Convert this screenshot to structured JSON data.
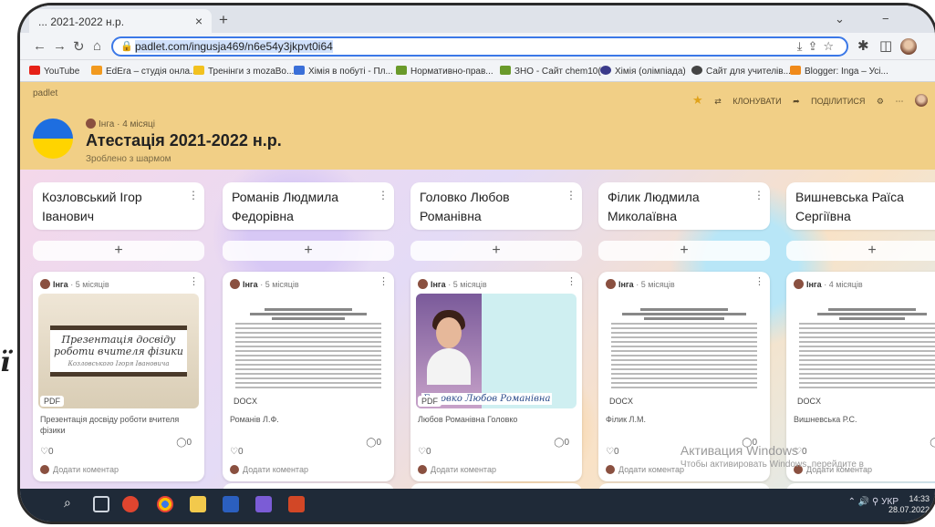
{
  "browser": {
    "tab_title": "... 2021-2022 н.р.",
    "url_host": "padlet.com",
    "url_path": "/ingusja469/n6e54y3jkpvt0i64",
    "bookmarks": [
      {
        "label": "YouTube",
        "color": "#e62117"
      },
      {
        "label": "EdEra – студія онла...",
        "color": "#f29a1f"
      },
      {
        "label": "Тренінги з mozaBo...",
        "color": "#f2c11f"
      },
      {
        "label": "Хімія в побуті - Пл...",
        "color": "#3a6fd8"
      },
      {
        "label": "Нормативно-прав...",
        "color": "#6a9a2a"
      },
      {
        "label": "ЗНО - Сайт chem10(",
        "color": "#6a9a2a"
      },
      {
        "label": "Хімія (олімпіада)",
        "color": "#3a3a8a"
      },
      {
        "label": "Сайт для учителів...",
        "color": "#444444"
      },
      {
        "label": "Blogger: Inga – Усі...",
        "color": "#f08a1a"
      }
    ]
  },
  "padlet": {
    "logo": "padlet",
    "author": "Інга",
    "age": "4 місяці",
    "title": "Атестація 2021-2022 н.р.",
    "subtitle": "Зроблено з шармом",
    "actions": {
      "clone": "КЛОНУВАТИ",
      "share": "ПОДІЛИТИСЯ"
    }
  },
  "columns": [
    {
      "title_line1": "Козловський Ігор",
      "title_line2": "Іванович",
      "card": {
        "author": "Інга",
        "age": "5 місяців",
        "type": "PDF",
        "slide_title": "Презентація досвіду роботи вчителя фізики",
        "slide_sub": "Козловського Ігоря Івановича",
        "caption": "Презентація досвіду роботи вчителя фізики",
        "likes": "0",
        "comments": "0",
        "add_comment": "Додати коментар"
      }
    },
    {
      "title_line1": "Романів Людмила",
      "title_line2": "Федорівна",
      "card": {
        "author": "Інга",
        "age": "5 місяців",
        "type": "DOCX",
        "caption": "Романів Л.Ф.",
        "likes": "0",
        "comments": "0",
        "add_comment": "Додати коментар"
      }
    },
    {
      "title_line1": "Головко Любов",
      "title_line2": "Романівна",
      "card": {
        "author": "Інга",
        "age": "5 місяців",
        "type": "PDF",
        "photo_name": "Головко Любов Романівна",
        "caption": "Любов Романівна Головко",
        "likes": "0",
        "comments": "0",
        "add_comment": "Додати коментар"
      }
    },
    {
      "title_line1": "Філик Людмила",
      "title_line2": "Миколаївна",
      "card": {
        "author": "Інга",
        "age": "5 місяців",
        "type": "DOCX",
        "caption": "Філик Л.М.",
        "likes": "0",
        "comments": "0",
        "add_comment": "Додати коментар"
      }
    },
    {
      "title_line1": "Вишневська Раїса",
      "title_line2": "Сергіївна",
      "card": {
        "author": "Інга",
        "age": "4 місяців",
        "type": "DOCX",
        "caption": "Вишневська Р.С.",
        "likes": "0",
        "comments": "0",
        "add_comment": "Додати коментар"
      }
    }
  ],
  "watermark": {
    "line1": "Активация Windows",
    "line2": "Чтобы активировать Windows, перейдите в"
  },
  "taskbar": {
    "lang": "УКР",
    "time": "14:33",
    "date": "28.07.2022"
  }
}
